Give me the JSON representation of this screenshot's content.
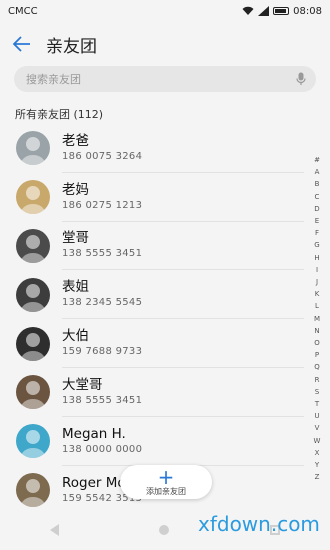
{
  "status": {
    "carrier": "CMCC",
    "time": "08:08"
  },
  "header": {
    "title": "亲友团"
  },
  "search": {
    "placeholder": "搜索亲友团"
  },
  "list": {
    "section_title": "所有亲友团 (112)",
    "contacts": [
      {
        "name": "老爸",
        "phone": "186 0075 3264",
        "avatar_color": "#9aa3a8"
      },
      {
        "name": "老妈",
        "phone": "186 0275 1213",
        "avatar_color": "#c9a86b"
      },
      {
        "name": "堂哥",
        "phone": "138 5555 3451",
        "avatar_color": "#4b4b4b"
      },
      {
        "name": "表姐",
        "phone": "138 2345 5545",
        "avatar_color": "#3d3d3d"
      },
      {
        "name": "大伯",
        "phone": "159 7688 9733",
        "avatar_color": "#2e2e2e"
      },
      {
        "name": "大堂哥",
        "phone": "138 5555 3451",
        "avatar_color": "#6b5440"
      },
      {
        "name": "Megan H.",
        "phone": "138 0000 0000",
        "avatar_color": "#3fa7c9"
      },
      {
        "name": "Roger Mo",
        "phone": "159 5542 3515",
        "avatar_color": "#7d6a4f"
      }
    ]
  },
  "index_letters": [
    "#",
    "A",
    "B",
    "C",
    "D",
    "E",
    "F",
    "G",
    "H",
    "I",
    "J",
    "K",
    "L",
    "M",
    "N",
    "O",
    "P",
    "Q",
    "R",
    "S",
    "T",
    "U",
    "V",
    "W",
    "X",
    "Y",
    "Z"
  ],
  "fab": {
    "icon": "+",
    "label": "添加亲友团"
  },
  "watermark": "xfdown.com",
  "colors": {
    "accent": "#2a78d6",
    "background": "#f4f4f4"
  }
}
